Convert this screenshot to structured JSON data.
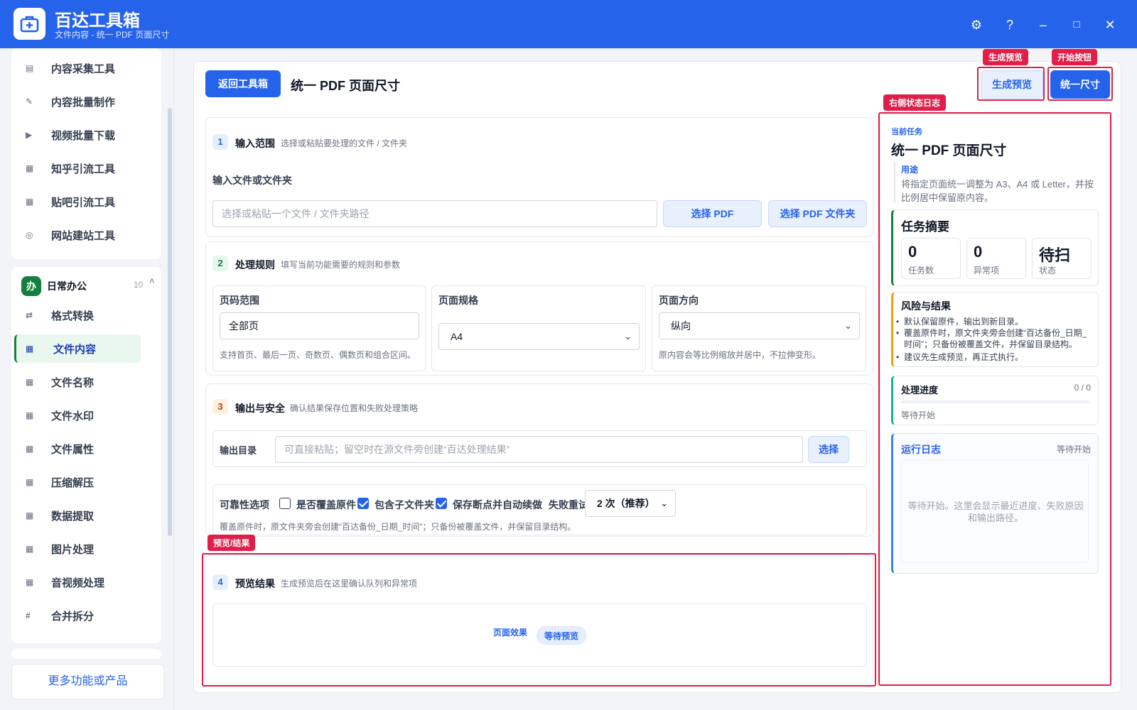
{
  "app": {
    "title": "百达工具箱",
    "subtitle": "文件内容 - 统一 PDF 页面尺寸",
    "window_buttons": [
      "⚙",
      "?",
      "–",
      "□",
      "✕"
    ]
  },
  "sidebar": {
    "group1_items": [
      {
        "label": "内容采集工具",
        "icon": "form-icon"
      },
      {
        "label": "内容批量制作",
        "icon": "pencil-icon"
      },
      {
        "label": "视频批量下载",
        "icon": "video-icon"
      },
      {
        "label": "知乎引流工具",
        "icon": "doc-icon"
      },
      {
        "label": "贴吧引流工具",
        "icon": "doc-icon"
      },
      {
        "label": "网站建站工具",
        "icon": "globe-icon"
      }
    ],
    "group2": {
      "badge": "办",
      "label": "日常办公",
      "count": "10",
      "caret": "˄",
      "items": [
        {
          "label": "格式转换",
          "icon": "swap-icon"
        },
        {
          "label": "文件内容",
          "icon": "grid-icon"
        },
        {
          "label": "文件名称",
          "icon": "grid-icon"
        },
        {
          "label": "文件水印",
          "icon": "grid-icon"
        },
        {
          "label": "文件属性",
          "icon": "grid-icon"
        },
        {
          "label": "压缩解压",
          "icon": "grid-icon"
        },
        {
          "label": "数据提取",
          "icon": "grid-icon"
        },
        {
          "label": "图片处理",
          "icon": "grid-icon"
        },
        {
          "label": "音视频处理",
          "icon": "grid-icon"
        },
        {
          "label": "合并拆分",
          "icon": "hash-icon"
        }
      ],
      "active_index": 1
    },
    "more_button": "更多功能或产品"
  },
  "header": {
    "back_button": "返回工具箱",
    "title": "统一 PDF 页面尺寸",
    "preview_button": "生成预览",
    "start_button": "统一尺寸"
  },
  "annotations": {
    "preview_tag": "生成预览",
    "start_tag": "开始按钮",
    "log_tag": "右侧状态日志",
    "result_tag": "预览/结果"
  },
  "section1": {
    "num": "1",
    "title": "输入范围",
    "desc": "选择或粘贴要处理的文件 / 文件夹",
    "field_label": "输入文件或文件夹",
    "input_placeholder": "选择或粘贴一个文件 / 文件夹路径",
    "pick_pdf": "选择 PDF",
    "pick_folder": "选择 PDF 文件夹"
  },
  "section2": {
    "num": "2",
    "title": "处理规则",
    "desc": "填写当前功能需要的规则和参数",
    "page_range": {
      "label": "页码范围",
      "value": "全部页",
      "hint": "支持首页、最后一页、奇数页、偶数页和组合区间。"
    },
    "page_size": {
      "label": "页面规格",
      "value": "A4"
    },
    "orientation": {
      "label": "页面方向",
      "value": "纵向",
      "hint": "原内容会等比例缩放并居中，不拉伸变形。"
    }
  },
  "section3": {
    "num": "3",
    "title": "输出与安全",
    "desc": "确认结果保存位置和失败处理策略",
    "output_label": "输出目录",
    "output_placeholder": "可直接粘贴；留空时在源文件旁创建“百达处理结果”",
    "output_pick": "选择",
    "reliability_label": "可靠性选项",
    "overwrite_label": "是否覆盖原件",
    "overwrite_checked": false,
    "subfolder_label": "包含子文件夹",
    "subfolder_checked": true,
    "resume_label": "保存断点并自动续做",
    "resume_checked": true,
    "retry_label": "失败重试",
    "retry_value": "2 次（推荐）",
    "note": "覆盖原件时，原文件夹旁会创建“百达备份_日期_时间”；只备份被覆盖文件，并保留目录结构。"
  },
  "section4": {
    "num": "4",
    "title": "预览结果",
    "desc": "生成预览后在这里确认队列和异常项",
    "effect_label": "页面效果",
    "status_chip": "等待预览"
  },
  "right_panel": {
    "current_label": "当前任务",
    "task_title": "统一 PDF 页面尺寸",
    "usage_label": "用途",
    "usage_text": "将指定页面统一调整为 A3、A4 或 Letter，并按比例居中保留原内容。",
    "summary_title": "任务摘要",
    "stats": [
      {
        "value": "0",
        "label": "任务数"
      },
      {
        "value": "0",
        "label": "异常项"
      },
      {
        "value": "待扫",
        "label": "状态"
      }
    ],
    "risk_title": "风险与结果",
    "risk_items": [
      "默认保留原件，输出到新目录。",
      "覆盖原件时，原文件夹旁会创建“百达备份_日期_时间”；只备份被覆盖文件，并保留目录结构。",
      "建议先生成预览，再正式执行。"
    ],
    "progress_title": "处理进度",
    "progress_count": "0 / 0",
    "progress_fraction": 0,
    "progress_status": "等待开始",
    "log_title": "运行日志",
    "log_status": "等待开始",
    "log_placeholder": "等待开始。这里会显示最近进度、失败原因和输出路径。"
  },
  "colors": {
    "brand": "#2563eb",
    "sidebar_active": "#15803d",
    "annotation": "#e11d48"
  }
}
